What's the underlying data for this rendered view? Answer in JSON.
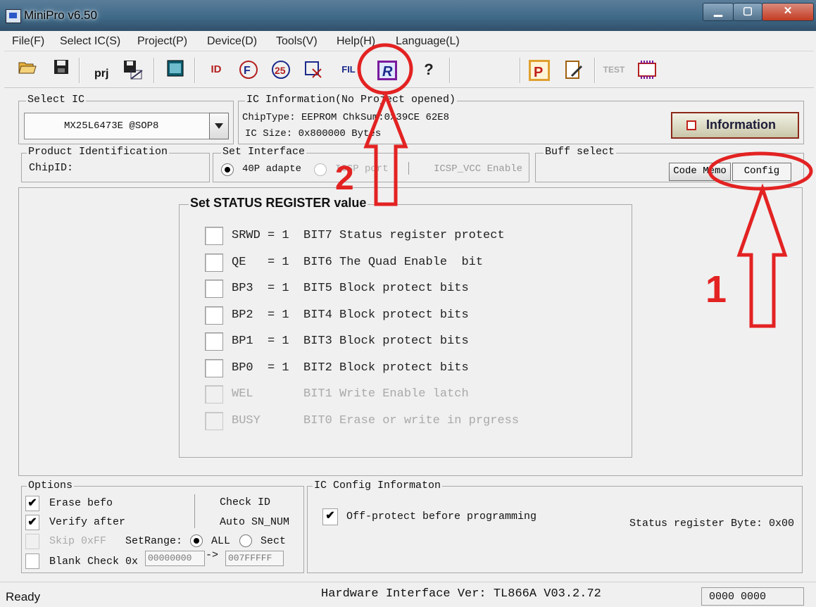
{
  "window": {
    "title": "MiniPro v6.50",
    "min": "▁",
    "max": "▢",
    "close": "✕"
  },
  "menu": [
    "File(F)",
    "Select IC(S)",
    "Project(P)",
    "Device(D)",
    "Tools(V)",
    "Help(H)",
    "Language(L)"
  ],
  "toolbar": {
    "prj_label": "prj",
    "id_label": "ID",
    "fil_label": "FIL",
    "r_label": "R",
    "help_label": "?",
    "p_label": "P",
    "test_label": "TEST"
  },
  "select_ic": {
    "legend": "Select IC",
    "value": "MX25L6473E @SOP8"
  },
  "ic_info": {
    "legend": "IC Information(No Project opened)",
    "chiptype": "ChipType:  EEPROM    ChkSum:0x39CE 62E8",
    "icsize": "IC Size:   0x800000 Bytes"
  },
  "info_button": "Information",
  "product_id": {
    "legend": "Product Identification",
    "chipid": "ChipID:"
  },
  "interface": {
    "legend": "Set Interface",
    "opt1": "40P adapte",
    "opt2": "ICSP port",
    "vcc": "ICSP_VCC Enable"
  },
  "buff": {
    "legend": "Buff select",
    "code_memo": "Code Memo",
    "config": "Config"
  },
  "status_register": {
    "legend": "Set STATUS REGISTER value",
    "rows": [
      {
        "text": "SRWD = 1  BIT7 Status register protect",
        "enabled": true
      },
      {
        "text": "QE   = 1  BIT6 The Quad Enable  bit",
        "enabled": true
      },
      {
        "text": "BP3  = 1  BIT5 Block protect bits",
        "enabled": true
      },
      {
        "text": "BP2  = 1  BIT4 Block protect bits",
        "enabled": true
      },
      {
        "text": "BP1  = 1  BIT3 Block protect bits",
        "enabled": true
      },
      {
        "text": "BP0  = 1  BIT2 Block protect bits",
        "enabled": true
      },
      {
        "text": "WEL       BIT1 Write Enable latch",
        "enabled": false
      },
      {
        "text": "BUSY      BIT0 Erase or write in prgress",
        "enabled": false
      }
    ]
  },
  "options": {
    "legend": "Options",
    "erase": "Erase befo",
    "verify": "Verify after",
    "skip": "Skip 0xFF",
    "blank": "Blank Check 0x",
    "check_id": "Check ID",
    "auto_sn": "Auto SN_NUM",
    "setrange": "SetRange:",
    "all": "ALL",
    "sect": "Sect",
    "range_from": "00000000",
    "arrow": "->",
    "range_to": "007FFFFF",
    "check": "✔"
  },
  "ic_config": {
    "legend": "IC Config Informaton",
    "off_protect": "Off-protect before programming",
    "status_byte": "Status register Byte: 0x00",
    "check": "✔"
  },
  "statusbar": {
    "ready": "Ready",
    "hw": "Hardware Interface Ver: TL866A V03.2.72",
    "counter": "0000 0000"
  },
  "annotations": {
    "label1": "1",
    "label2": "2"
  },
  "colors": {
    "annotation_red": "#e32222",
    "title_bar": "#3f6a88"
  }
}
